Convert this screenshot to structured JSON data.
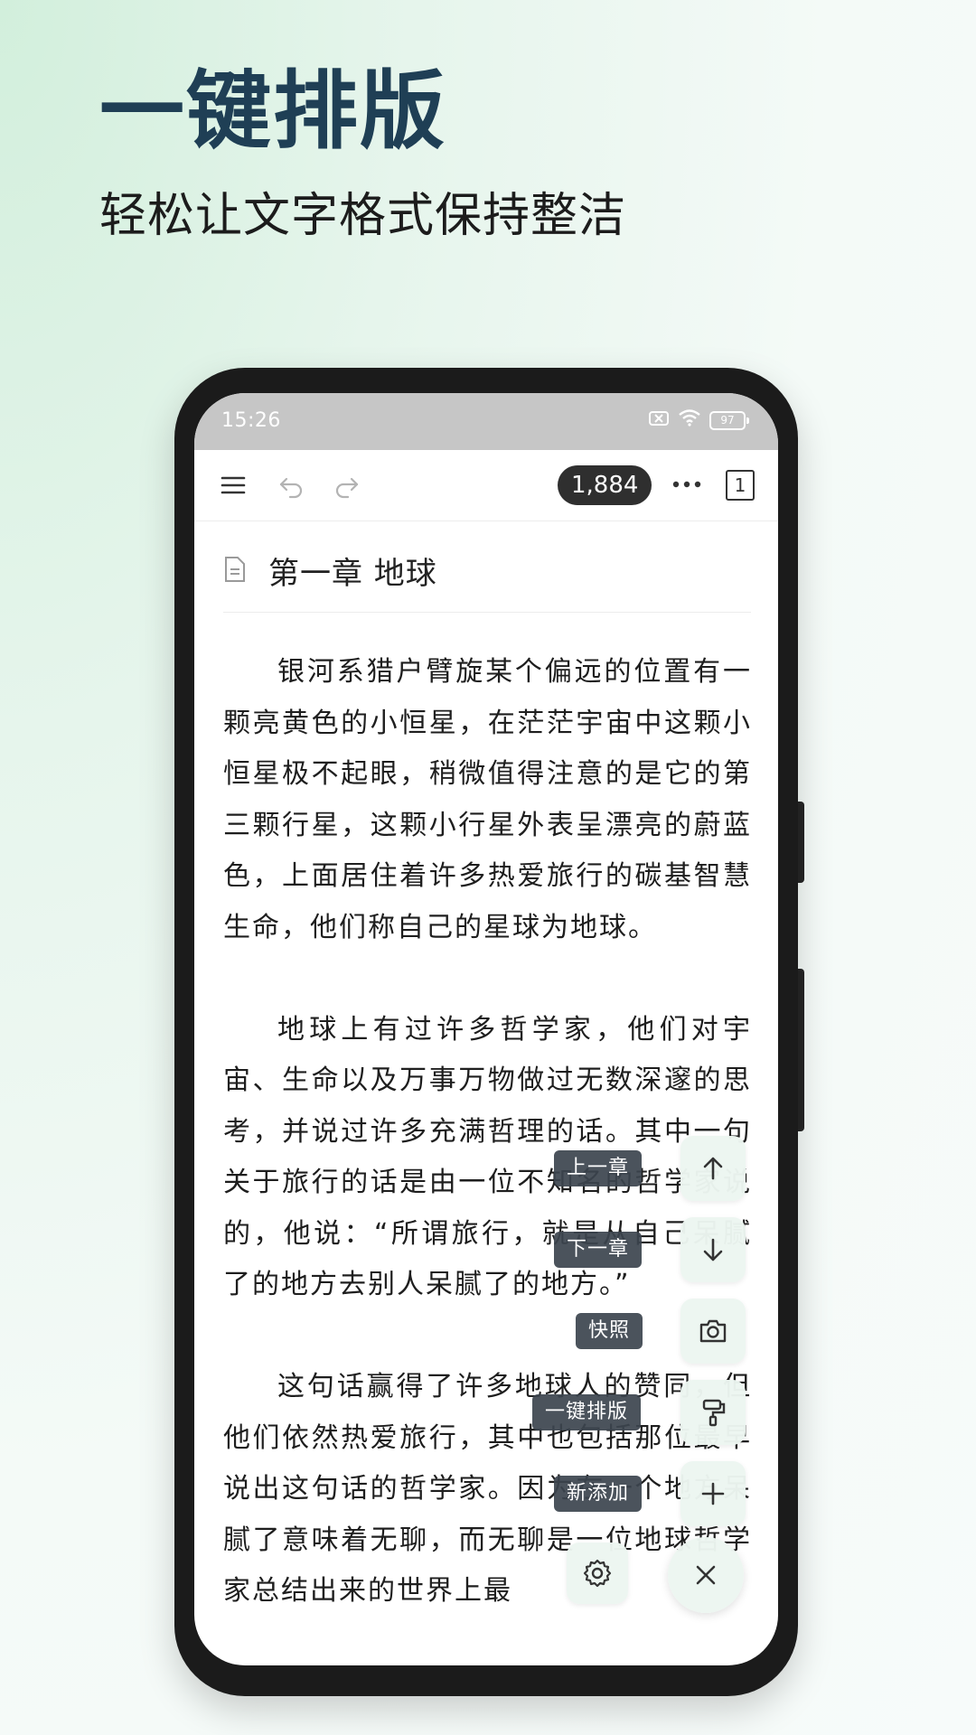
{
  "promo": {
    "headline": "一键排版",
    "subheadline": "轻松让文字格式保持整洁"
  },
  "status_bar": {
    "time": "15:26",
    "battery": "97",
    "icons": [
      "sim-off-icon",
      "wifi-icon",
      "battery-icon"
    ]
  },
  "toolbar": {
    "menu_icon": "menu-icon",
    "undo_icon": "undo-icon",
    "redo_icon": "redo-icon",
    "word_count": "1,884",
    "more_icon": "more-icon",
    "page_count": "1"
  },
  "document": {
    "title": "第一章 地球",
    "paragraphs": [
      "银河系猎户臂旋某个偏远的位置有一颗亮黄色的小恒星，在茫茫宇宙中这颗小恒星极不起眼，稍微值得注意的是它的第三颗行星，这颗小行星外表呈漂亮的蔚蓝色，上面居住着许多热爱旅行的碳基智慧生命，他们称自己的星球为地球。",
      "地球上有过许多哲学家，他们对宇宙、生命以及万事万物做过无数深邃的思考，并说过许多充满哲理的话。其中一句关于旅行的话是由一位不知名的哲学家说的，他说：“所谓旅行，就是从自己呆腻了的地方去别人呆腻了的地方。”",
      "这句话赢得了许多地球人的赞同，但他们依然热爱旅行，其中也包括那位最早说出这句话的哲学家。因为在一个地方呆腻了意味着无聊，而无聊是一位地球哲学家总结出来的世界上最"
    ]
  },
  "fab_menu": {
    "prev_chapter": "上一章",
    "next_chapter": "下一章",
    "snapshot": "快照",
    "one_click_format": "一键排版",
    "add_new": "新添加"
  },
  "colors": {
    "headline": "#1f3f55",
    "status_bar_bg": "#c6c6c6",
    "badge_bg": "#2f2f2f",
    "fab_bg": "#ecf6f1",
    "tag_bg": "#3c444e"
  }
}
